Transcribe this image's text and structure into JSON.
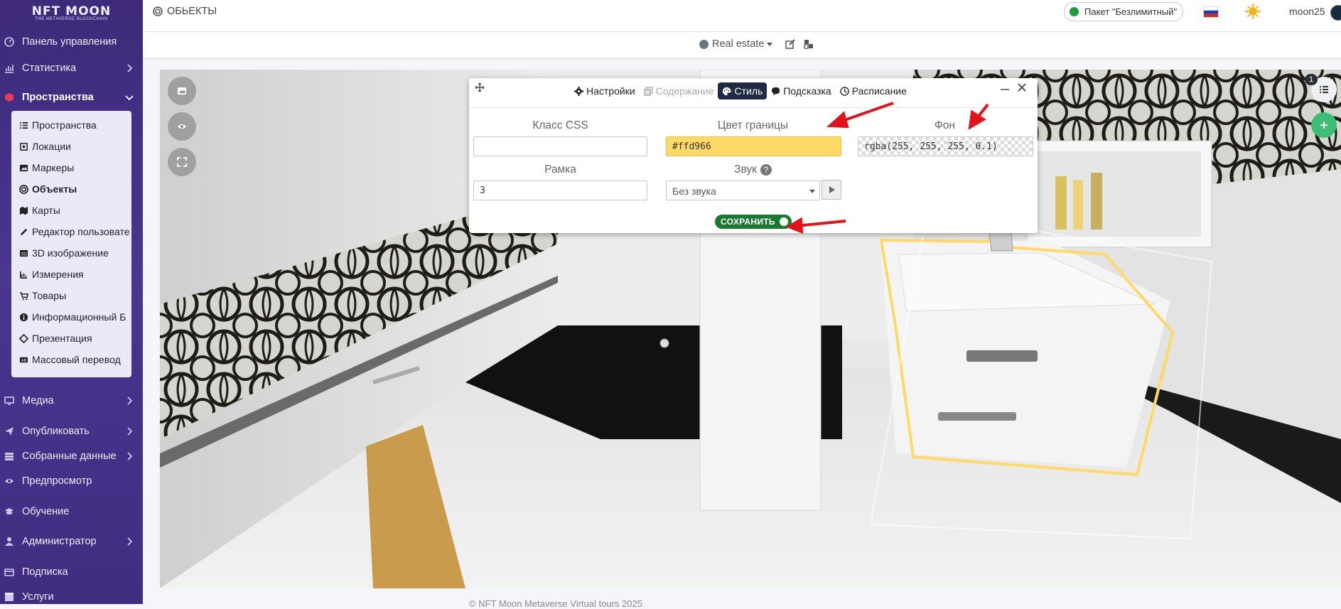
{
  "sidebar": {
    "logo": {
      "title": "NFT MOON",
      "tagline": "THE METAVERSE BLOCKCHAIN"
    },
    "items": [
      {
        "label": "Панель управления",
        "icon": "dashboard-icon"
      },
      {
        "label": "Статистика",
        "icon": "chart-icon"
      },
      {
        "label": "Пространства",
        "icon": "cube-icon"
      },
      {
        "label": "Медиа",
        "icon": "monitor-icon"
      },
      {
        "label": "Опубликовать",
        "icon": "send-icon"
      },
      {
        "label": "Собранные данные",
        "icon": "database-icon"
      },
      {
        "label": "Предпросмотр",
        "icon": "eye-icon"
      },
      {
        "label": "Обучение",
        "icon": "graduation-icon"
      },
      {
        "label": "Администратор",
        "icon": "user-icon"
      },
      {
        "label": "Подписка",
        "icon": "card-icon"
      },
      {
        "label": "Услуги",
        "icon": "box-icon"
      }
    ],
    "subitems": [
      {
        "label": "Пространства",
        "icon": "list-icon"
      },
      {
        "label": "Локации",
        "icon": "location-icon"
      },
      {
        "label": "Маркеры",
        "icon": "image-icon"
      },
      {
        "label": "Объекты",
        "icon": "target-icon"
      },
      {
        "label": "Карты",
        "icon": "map-icon"
      },
      {
        "label": "Редактор пользовате",
        "icon": "pencil-icon"
      },
      {
        "label": "3D изображение",
        "icon": "3d-icon"
      },
      {
        "label": "Измерения",
        "icon": "ruler-icon"
      },
      {
        "label": "Товары",
        "icon": "cart-icon"
      },
      {
        "label": "Информационный Б",
        "icon": "info-icon"
      },
      {
        "label": "Презентация",
        "icon": "diamond-icon"
      },
      {
        "label": "Массовый перевод",
        "icon": "translate-icon"
      }
    ]
  },
  "topbar": {
    "title": "ОБЬЕКТЫ",
    "plan": "Пакет \"Безлимитный\"",
    "user": "moon25"
  },
  "subbar": {
    "space": "Real estate"
  },
  "viewer": {
    "list_count": "1"
  },
  "editor": {
    "tabs": [
      {
        "label": "Настройки",
        "icon": "gear-icon"
      },
      {
        "label": "Содержание",
        "icon": "copy-icon"
      },
      {
        "label": "Стиль",
        "icon": "palette-icon"
      },
      {
        "label": "Подсказка",
        "icon": "comment-icon"
      },
      {
        "label": "Расписание",
        "icon": "clock-icon"
      }
    ],
    "css_class_label": "Класс CSS",
    "css_class_value": "",
    "border_color_label": "Цвет границы",
    "border_color_value": "#ffd966",
    "background_label": "Фон",
    "background_value": "rgba(255, 255, 255, 0.1)",
    "frame_label": "Рамка",
    "frame_value": "3",
    "sound_label": "Звук",
    "sound_value": "Без звука",
    "save_label": "СОХРАНИТЬ"
  },
  "footer": {
    "text": "© NFT Moon Metaverse Virtual tours 2025"
  },
  "colors": {
    "sidebar_bg": "#45318a",
    "active_tab": "#1f2a44",
    "save": "#177a30",
    "highlight": "#ffd966",
    "annotation_arrow": "#e0141a"
  }
}
